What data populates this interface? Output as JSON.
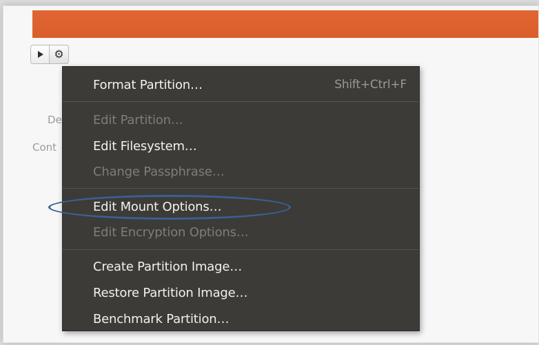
{
  "colors": {
    "accent_orange": "#e06633",
    "menu_bg": "#3c3b37",
    "menu_text": "#f2f1ed",
    "menu_text_disabled": "#7f7d76",
    "annotation_ellipse": "#3b5f94"
  },
  "toolbar": {
    "play_icon": "play-icon",
    "gear_icon": "gear-icon",
    "gear_glyph": "⚙"
  },
  "background_labels": {
    "label_1": "De",
    "label_2": "Cont"
  },
  "menu": {
    "format_partition": "Format Partition…",
    "format_partition_shortcut": "Shift+Ctrl+F",
    "edit_partition": "Edit Partition…",
    "edit_filesystem": "Edit Filesystem…",
    "change_passphrase": "Change Passphrase…",
    "edit_mount_options": "Edit Mount Options…",
    "edit_encryption_options": "Edit Encryption Options…",
    "create_partition_image": "Create Partition Image…",
    "restore_partition_image": "Restore Partition Image…",
    "benchmark_partition": "Benchmark Partition…"
  }
}
